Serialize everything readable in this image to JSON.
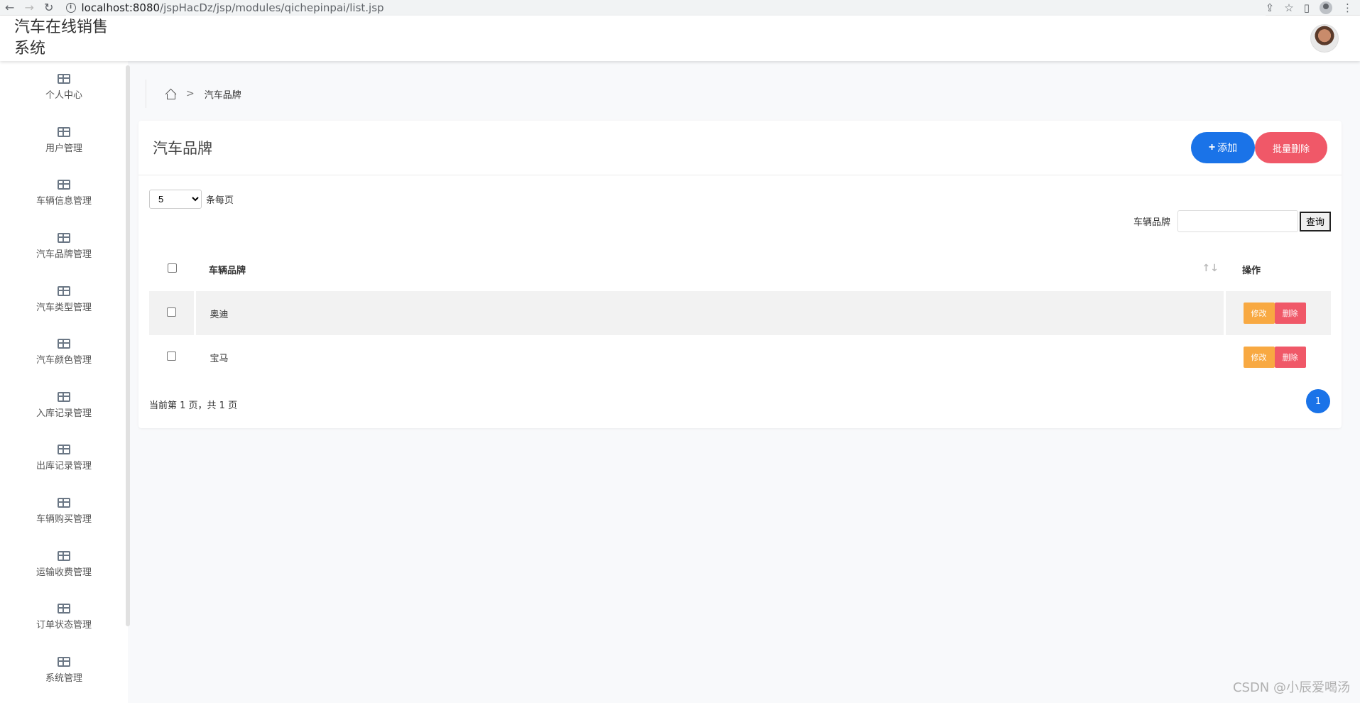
{
  "browser": {
    "url_host": "localhost:8080",
    "url_path": "/jspHacDz/jsp/modules/qichepinpai/list.jsp"
  },
  "app": {
    "title": "汽车在线销售系统"
  },
  "sidebar": {
    "items": [
      {
        "label": "个人中心"
      },
      {
        "label": "用户管理"
      },
      {
        "label": "车辆信息管理"
      },
      {
        "label": "汽车品牌管理"
      },
      {
        "label": "汽车类型管理"
      },
      {
        "label": "汽车颜色管理"
      },
      {
        "label": "入库记录管理"
      },
      {
        "label": "出库记录管理"
      },
      {
        "label": "车辆购买管理"
      },
      {
        "label": "运输收费管理"
      },
      {
        "label": "订单状态管理"
      },
      {
        "label": "系统管理"
      }
    ]
  },
  "breadcrumb": {
    "current": "汽车品牌"
  },
  "card": {
    "title": "汽车品牌",
    "add_label": "添加",
    "batch_delete_label": "批量删除"
  },
  "pagination": {
    "page_size": "5",
    "page_size_suffix": "条每页",
    "info": "当前第 1 页，共 1 页",
    "current_page": "1"
  },
  "search": {
    "label": "车辆品牌",
    "button": "查询",
    "value": ""
  },
  "table": {
    "headers": {
      "brand": "车辆品牌",
      "operation": "操作"
    },
    "rows": [
      {
        "brand": "奥迪",
        "edit": "修改",
        "delete": "删除"
      },
      {
        "brand": "宝马",
        "edit": "修改",
        "delete": "删除"
      }
    ]
  },
  "colors": {
    "primary": "#1a73e8",
    "danger": "#f05868",
    "warning": "#f8a942"
  },
  "watermark": "CSDN @小辰爱喝汤"
}
